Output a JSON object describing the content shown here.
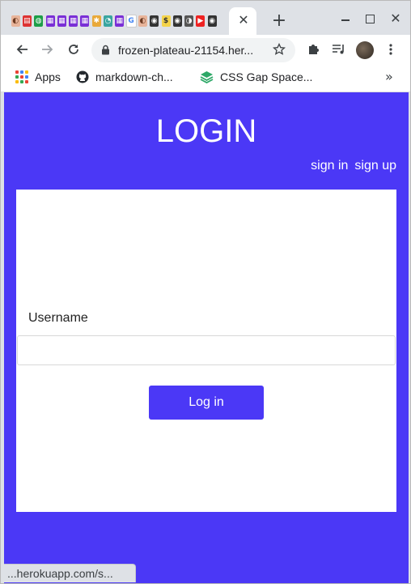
{
  "browser": {
    "tab_close_glyph": "✕",
    "new_tab_glyph": "+",
    "url": "frozen-plateau-21154.her...",
    "window_close_glyph": "✕"
  },
  "bookmarks": [
    {
      "label": "Apps",
      "icon": "apps-grid-icon"
    },
    {
      "label": "markdown-ch...",
      "icon": "github-icon"
    },
    {
      "label": "CSS Gap Space...",
      "icon": "css-layers-icon"
    }
  ],
  "bookmarks_more_glyph": "»",
  "page": {
    "title": "LOGIN",
    "nav": [
      "sign in",
      "sign up"
    ],
    "username_label": "Username",
    "username_value": "",
    "login_button": "Log in"
  },
  "status_bar": "...herokuapp.com/s...",
  "colors": {
    "accent": "#4b38f6",
    "card": "#ffffff",
    "chrome_frame": "#dee1e6"
  }
}
